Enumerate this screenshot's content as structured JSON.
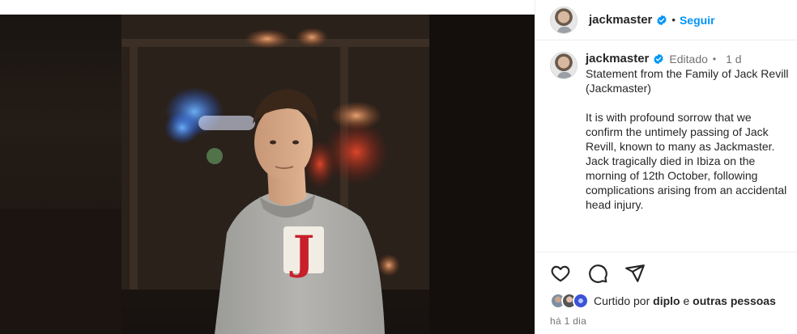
{
  "post": {
    "author": {
      "username": "jackmaster",
      "verified": true,
      "follow_label": "Seguir"
    },
    "caption": {
      "username": "jackmaster",
      "edited_label": "Editado",
      "time": "1 d",
      "text": "Statement from the Family of Jack Revill (Jackmaster)\n\nIt is with profound sorrow that we confirm the untimely passing of Jack Revill, known to many as Jackmaster. Jack tragically died in Ibiza on the morning of 12th October, following complications arising from an accidental head injury."
    },
    "likes": {
      "prefix": "Curtido por",
      "user": "diplo",
      "connector": "e",
      "others": "outras pessoas"
    },
    "posted_ago": "há 1 dia"
  },
  "photo": {
    "sweater_letter": "J"
  },
  "colors": {
    "accent": "#0095f6",
    "verified": "#0095f6",
    "muted_text": "#737373",
    "sweater_letter": "#c8202a"
  },
  "icons": [
    "verified-badge-icon",
    "heart-icon",
    "comment-icon",
    "share-icon"
  ]
}
